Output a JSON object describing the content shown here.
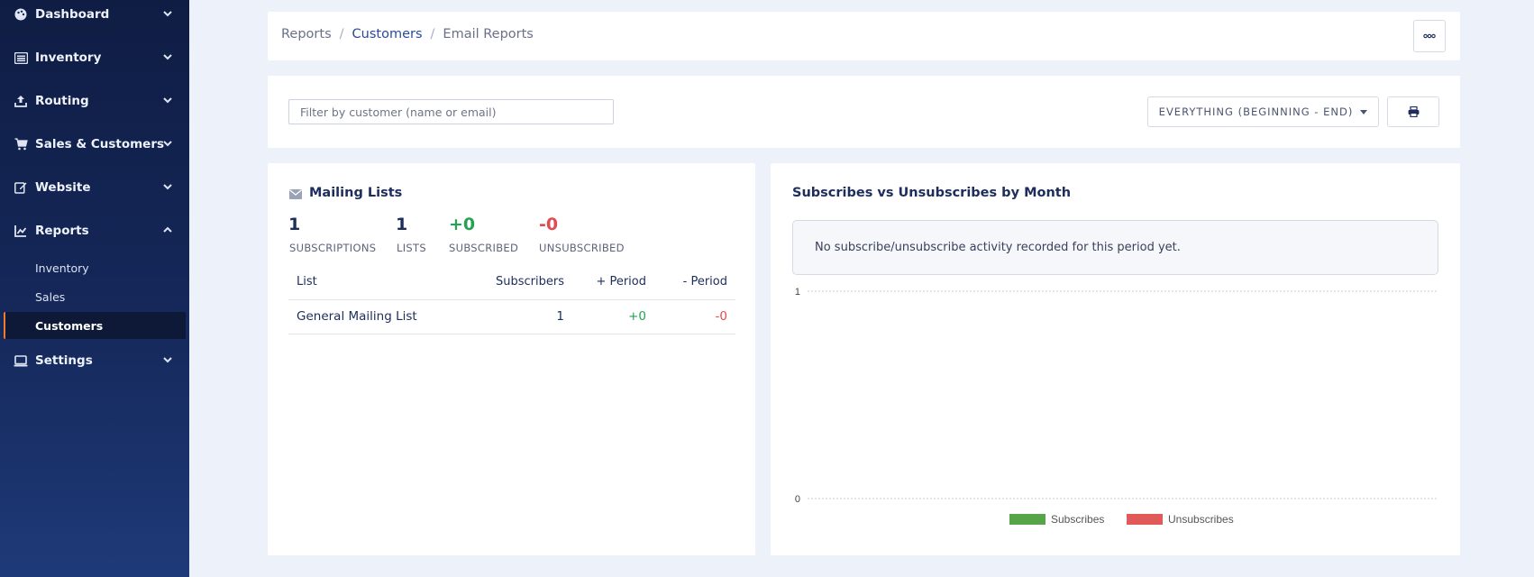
{
  "sidebar": {
    "items": [
      {
        "label": "Dashboard",
        "icon": "palette-icon"
      },
      {
        "label": "Inventory",
        "icon": "list-icon"
      },
      {
        "label": "Routing",
        "icon": "upload-icon"
      },
      {
        "label": "Sales & Customers",
        "icon": "cart-icon"
      },
      {
        "label": "Website",
        "icon": "edit-icon"
      },
      {
        "label": "Reports",
        "icon": "chart-icon",
        "expanded": true
      },
      {
        "label": "Settings",
        "icon": "laptop-icon"
      }
    ],
    "reports_sub": [
      "Inventory",
      "Sales",
      "Customers"
    ],
    "active_sub": "Customers",
    "active_accent": "#f07b2c"
  },
  "breadcrumb": {
    "items": [
      "Reports",
      "Customers",
      "Email Reports"
    ],
    "separator": "/"
  },
  "filter": {
    "placeholder": "Filter by customer (name or email)",
    "value": ""
  },
  "range": {
    "label": "EVERYTHING (BEGINNING - END)"
  },
  "mailing": {
    "title": "Mailing Lists",
    "stats": [
      {
        "value": "1",
        "label": "SUBSCRIPTIONS"
      },
      {
        "value": "1",
        "label": "LISTS"
      },
      {
        "value": "+0",
        "label": "SUBSCRIBED"
      },
      {
        "value": "-0",
        "label": "UNSUBSCRIBED"
      }
    ],
    "table": {
      "headers": [
        "List",
        "Subscribers",
        "+ Period",
        "- Period"
      ],
      "rows": [
        {
          "list": "General Mailing List",
          "subscribers": "1",
          "plus": "+0",
          "minus": "-0"
        }
      ]
    }
  },
  "chart_panel": {
    "title": "Subscribes vs Unsubscribes by Month",
    "notice": "No subscribe/unsubscribe activity recorded for this period yet."
  },
  "chart_data": {
    "type": "bar",
    "title": "Subscribes vs Unsubscribes by Month",
    "categories": [],
    "series": [
      {
        "name": "Subscribes",
        "values": [],
        "color": "#57a548"
      },
      {
        "name": "Unsubscribes",
        "values": [],
        "color": "#e05a5a"
      }
    ],
    "ylim": [
      0,
      1
    ],
    "yticks": [
      "0",
      "1"
    ],
    "grid": true,
    "legend": "bottom-center"
  },
  "colors": {
    "accent": "#2a4a98",
    "positive": "#27a153",
    "negative": "#e14a52"
  }
}
